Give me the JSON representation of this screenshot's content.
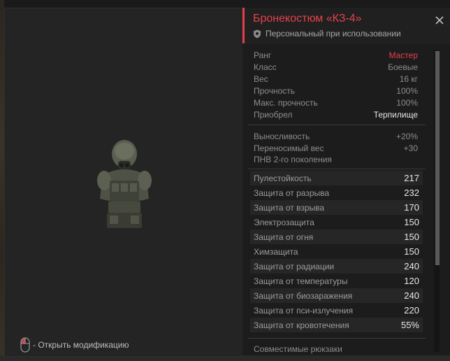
{
  "item": {
    "title": "Бронекостюм «КЗ-4»",
    "subtitle": "Персональный при использовании"
  },
  "info": [
    {
      "key": "Ранг",
      "value": "Мастер"
    },
    {
      "key": "Класс",
      "value": "Боевые"
    },
    {
      "key": "Вес",
      "value": "16 кг"
    },
    {
      "key": "Прочность",
      "value": "100%"
    },
    {
      "key": "Макс. прочность",
      "value": "100%"
    },
    {
      "key": "Приобрел",
      "value": "Терпилище"
    }
  ],
  "bonuses": [
    {
      "key": "Выносливость",
      "value": "+20%"
    },
    {
      "key": "Переносимый вес",
      "value": "+30"
    },
    {
      "key": "ПНВ 2-го поколения",
      "value": ""
    }
  ],
  "stats": [
    {
      "key": "Пулестойкость",
      "value": "217"
    },
    {
      "key": "Защита от разрыва",
      "value": "232"
    },
    {
      "key": "Защита от взрыва",
      "value": "170"
    },
    {
      "key": "Электрозащита",
      "value": "150"
    },
    {
      "key": "Защита от огня",
      "value": "150"
    },
    {
      "key": "Химзащита",
      "value": "150"
    },
    {
      "key": "Защита от радиации",
      "value": "240"
    },
    {
      "key": "Защита от температуры",
      "value": "120"
    },
    {
      "key": "Защита от биозаражения",
      "value": "240"
    },
    {
      "key": "Защита от пси-излучения",
      "value": "220"
    },
    {
      "key": "Защита от кровотечения",
      "value": "55%"
    }
  ],
  "footer": {
    "backpacks_label": "Совместимые рюкзаки"
  },
  "viewer": {
    "mod_hint": "- Открыть модификацию"
  },
  "colors": {
    "accent": "#e5414b",
    "bonus": "#5ec95e",
    "panel_bg": "#1c1c1c",
    "viewer_bg": "#242424"
  },
  "icons": [
    "shield-icon",
    "close-icon",
    "mouse-icon"
  ]
}
